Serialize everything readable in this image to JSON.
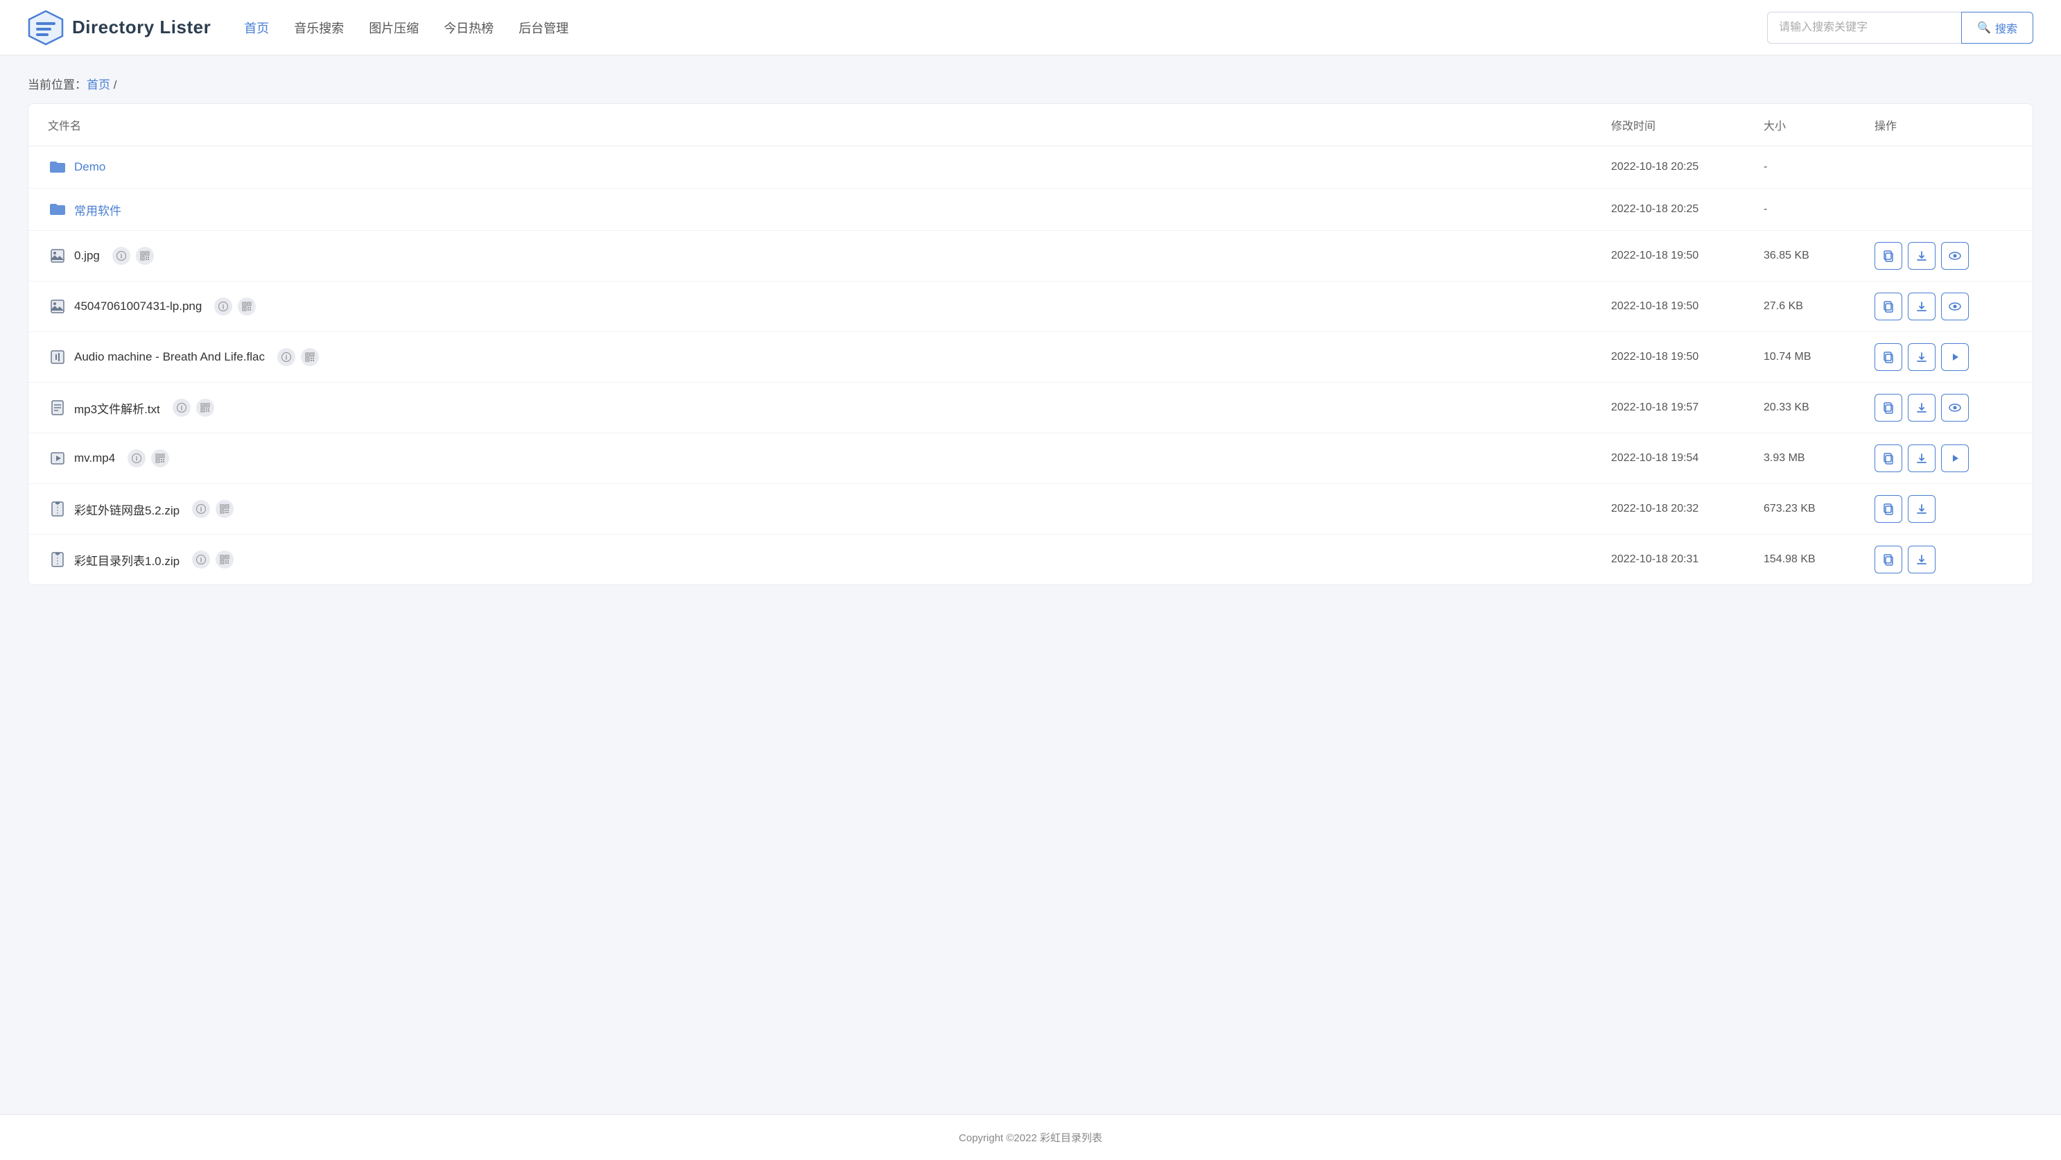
{
  "app": {
    "title": "Directory Lister"
  },
  "header": {
    "logo_text": "Directory Lister",
    "nav_items": [
      {
        "label": "首页",
        "active": true
      },
      {
        "label": "音乐搜索",
        "active": false
      },
      {
        "label": "图片压缩",
        "active": false
      },
      {
        "label": "今日热榜",
        "active": false
      },
      {
        "label": "后台管理",
        "active": false
      }
    ],
    "search_placeholder": "请输入搜索关键字",
    "search_button_label": "搜索"
  },
  "breadcrumb": {
    "prefix": "当前位置：",
    "home_label": "首页",
    "separator": " /"
  },
  "table": {
    "columns": {
      "name": "文件名",
      "modified": "修改时间",
      "size": "大小",
      "actions": "操作"
    },
    "rows": [
      {
        "type": "folder",
        "name": "Demo",
        "modified": "2022-10-18 20:25",
        "size": "-",
        "actions": []
      },
      {
        "type": "folder",
        "name": "常用软件",
        "modified": "2022-10-18 20:25",
        "size": "-",
        "actions": []
      },
      {
        "type": "image",
        "name": "0.jpg",
        "modified": "2022-10-18 19:50",
        "size": "36.85 KB",
        "actions": [
          "copy",
          "download",
          "preview"
        ]
      },
      {
        "type": "image",
        "name": "45047061007431-lp.png",
        "modified": "2022-10-18 19:50",
        "size": "27.6 KB",
        "actions": [
          "copy",
          "download",
          "preview"
        ]
      },
      {
        "type": "audio",
        "name": "Audio machine - Breath And Life.flac",
        "modified": "2022-10-18 19:50",
        "size": "10.74 MB",
        "actions": [
          "copy",
          "download",
          "play"
        ]
      },
      {
        "type": "text",
        "name": "mp3文件解析.txt",
        "modified": "2022-10-18 19:57",
        "size": "20.33 KB",
        "actions": [
          "copy",
          "download",
          "preview"
        ]
      },
      {
        "type": "video",
        "name": "mv.mp4",
        "modified": "2022-10-18 19:54",
        "size": "3.93 MB",
        "actions": [
          "copy",
          "download",
          "play"
        ]
      },
      {
        "type": "zip",
        "name": "彩虹外链网盘5.2.zip",
        "modified": "2022-10-18 20:32",
        "size": "673.23 KB",
        "actions": [
          "copy",
          "download"
        ]
      },
      {
        "type": "zip",
        "name": "彩虹目录列表1.0.zip",
        "modified": "2022-10-18 20:31",
        "size": "154.98 KB",
        "actions": [
          "copy",
          "download"
        ]
      }
    ]
  },
  "footer": {
    "text": "Copyright ©2022 彩虹目录列表"
  },
  "icons": {
    "search": "🔍",
    "folder": "📁",
    "file": "📄",
    "copy": "⧉",
    "download": "⬇",
    "preview": "👁",
    "play": "▶",
    "info": "ℹ",
    "qr": "⊞"
  }
}
